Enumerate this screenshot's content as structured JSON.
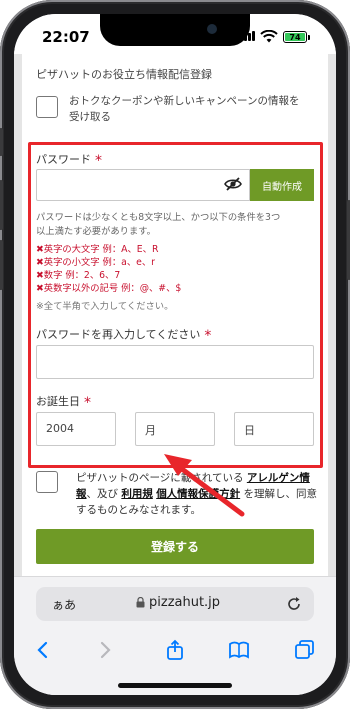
{
  "status": {
    "time": "22:07",
    "battery": "74"
  },
  "newsletter": {
    "heading": "ピザハットのお役立ち情報配信登録",
    "checkbox_line1": "おトクなクーポンや新しいキャンペーンの情報を",
    "checkbox_line2": "受け取る"
  },
  "password": {
    "label": "パスワード",
    "required_mark": "*",
    "auto_button": "自動作成",
    "requirements_line1": "パスワードは少なくとも8文字以上、かつ以下の条件を3つ",
    "requirements_line2": "以上満たす必要があります。",
    "rules": [
      "✖英字の大文字 例：A、E、R",
      "✖英字の小文字 例：a、e、r",
      "✖数字 例：2、6、7",
      "✖英数字以外の記号 例：@、#、$"
    ],
    "note": "※全て半角で入力してください。"
  },
  "password_confirm": {
    "label": "パスワードを再入力してください",
    "required_mark": "*"
  },
  "birthday": {
    "label": "お誕生日",
    "required_mark": "*",
    "year": "2004",
    "month": "月",
    "day": "日"
  },
  "agreement": {
    "part1": "ピザハットのページに",
    "part2": "載されている",
    "link1": "アレルゲン情報",
    "part3": "、及び",
    "link2": "利用規",
    "part4": "個人情報保護方針",
    "part5": "を理解し、同意するものとみなされます。"
  },
  "submit_label": "登録する",
  "browser": {
    "aa_label": "ぁあ",
    "url": "pizzahut.jp"
  },
  "colors": {
    "brand_green": "#6f9a26",
    "highlight_red": "#e8262b",
    "required_red": "#c8102e",
    "ios_blue": "#007aff"
  }
}
